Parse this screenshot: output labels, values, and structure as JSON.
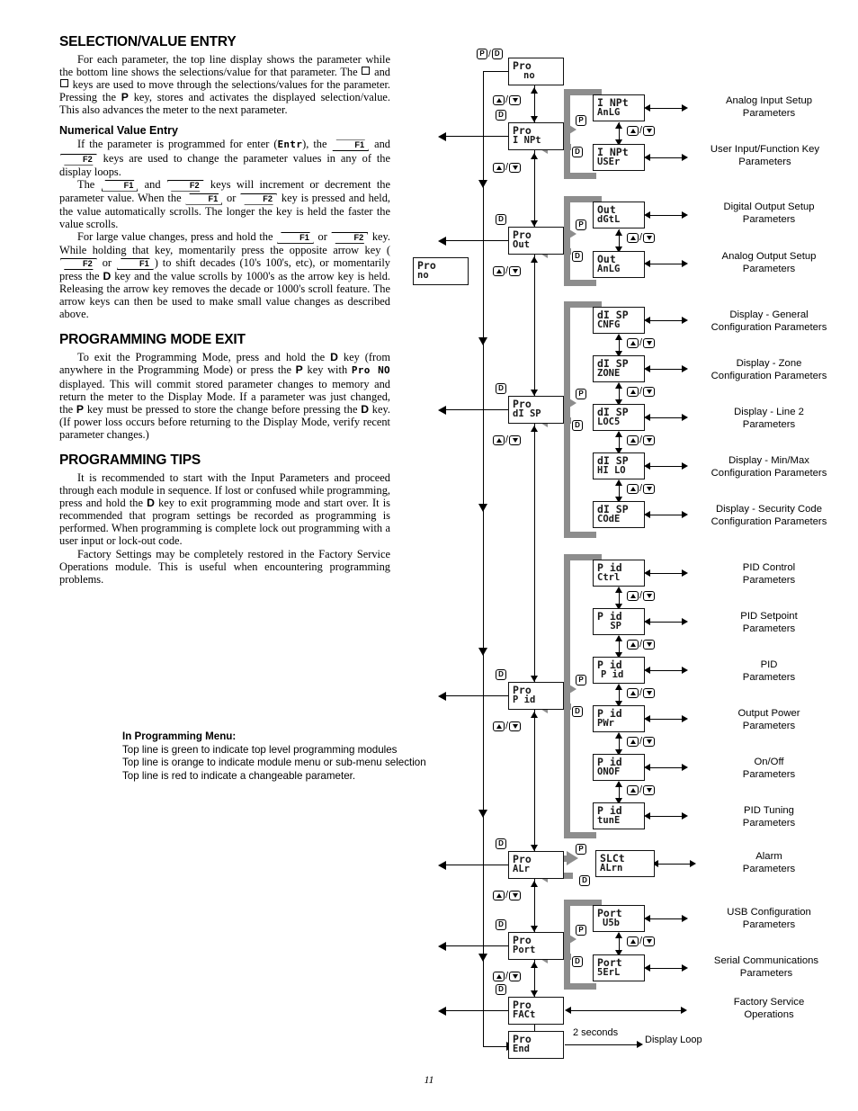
{
  "document": {
    "page_number": "11"
  },
  "sections": [
    {
      "id": "selection_value_entry",
      "heading": "SELECTION/VALUE ENTRY",
      "paragraphs": [
        "For each parameter, the top line display shows the parameter while the bottom line shows the selections/value for that parameter. The □ and □ keys are used to move through the selections/values for the parameter. Pressing the P key, stores and activates the displayed selection/value. This also advances the meter to the next parameter."
      ]
    },
    {
      "id": "numerical_value_entry",
      "heading": "Numerical Value Entry",
      "paragraphs": [
        "If the parameter is programmed for enter (Entr), the F1 and F2 keys are used to change the parameter values in any of the display loops.",
        "The F1 and F2 keys will increment or decrement the parameter value. When the F1 or F2 key is pressed and held, the value automatically scrolls. The longer the key is held the faster the value scrolls.",
        "For large value changes, press and hold the F1 or F2 key. While holding that key, momentarily press the opposite arrow key (F2 or F1) to shift decades (10's 100's, etc), or momentarily press the D key and the value scrolls by 1000's as the arrow key is held. Releasing the arrow key removes the decade or 1000's scroll feature. The arrow keys can then be used to make small value changes as described above."
      ]
    },
    {
      "id": "programming_mode_exit",
      "heading": "PROGRAMMING MODE EXIT",
      "paragraphs": [
        "To exit the Programming Mode, press and hold the D key (from anywhere in the Programming Mode) or press the P key with Pro NO displayed. This will commit stored parameter changes to memory and return the meter to the Display Mode. If a parameter was just changed, the P key must be pressed to store the change before pressing the D key. (If power loss occurs before returning to the Display Mode, verify recent parameter changes.)"
      ]
    },
    {
      "id": "programming_tips",
      "heading": "PROGRAMMING TIPS",
      "paragraphs": [
        "It is recommended to start with the Input Parameters and proceed through each module in sequence. If lost or confused while programming, press and hold the D key to exit programming mode and start over. It is recommended that program settings be recorded as programming is performed. When programming is complete lock out programming with a user input or lock-out code.",
        "Factory Settings may be completely restored in the Factory Service Operations module. This is useful when encountering programming problems."
      ]
    }
  ],
  "note": {
    "title": "In Programming Menu:",
    "lines": [
      "Top line is green to indicate top level programming modules",
      "Top line is orange to indicate module menu or sub-menu selection",
      "Top line is red to indicate a changeable parameter."
    ]
  },
  "flowchart": {
    "legend_box": {
      "line1": "Pro",
      "line2": "no"
    },
    "top_keys": {
      "p": "P",
      "d": "D",
      "slash": "/"
    },
    "key_labels": {
      "p": "P",
      "d": "D"
    },
    "main_modules": [
      {
        "id": "pro-no",
        "line1": "Pro",
        "line2": "no"
      },
      {
        "id": "pro-inpt",
        "line1": "Pro",
        "line2": "I NPt"
      },
      {
        "id": "pro-out",
        "line1": "Pro",
        "line2": "Out"
      },
      {
        "id": "pro-disp",
        "line1": "Pro",
        "line2": "dI SP"
      },
      {
        "id": "pro-pid",
        "line1": "Pro",
        "line2": "P id"
      },
      {
        "id": "pro-alr",
        "line1": "Pro",
        "line2": "ALr"
      },
      {
        "id": "pro-port",
        "line1": "Pro",
        "line2": "Port"
      },
      {
        "id": "pro-fact",
        "line1": "Pro",
        "line2": "FACt"
      },
      {
        "id": "pro-end",
        "line1": "Pro",
        "line2": "End"
      }
    ],
    "submodules": [
      {
        "id": "inpt-anlg",
        "line1": "I NPt",
        "line2": "AnLG",
        "label": "Analog Input Setup\nParameters"
      },
      {
        "id": "inpt-user",
        "line1": "I NPt",
        "line2": "USEr",
        "label": "User Input/Function Key\nParameters"
      },
      {
        "id": "out-dgtl",
        "line1": "Out",
        "line2": "dGtL",
        "label": "Digital Output Setup\nParameters"
      },
      {
        "id": "out-anlg",
        "line1": "Out",
        "line2": "AnLG",
        "label": "Analog Output Setup\nParameters"
      },
      {
        "id": "disp-cnfg",
        "line1": "dI SP",
        "line2": "CNFG",
        "label": "Display - General\nConfiguration Parameters"
      },
      {
        "id": "disp-zone",
        "line1": "dI SP",
        "line2": "ZONE",
        "label": "Display - Zone\nConfiguration Parameters"
      },
      {
        "id": "disp-locs",
        "line1": "dI SP",
        "line2": "LOC5",
        "label": "Display - Line 2\nParameters"
      },
      {
        "id": "disp-hilo",
        "line1": "dI SP",
        "line2": "HI LO",
        "label": "Display - Min/Max\nConfiguration Parameters"
      },
      {
        "id": "disp-code",
        "line1": "dI SP",
        "line2": "COdE",
        "label": "Display - Security Code\nConfiguration Parameters"
      },
      {
        "id": "pid-ctrl",
        "line1": "P id",
        "line2": "Ctrl",
        "label": "PID Control\nParameters"
      },
      {
        "id": "pid-sp",
        "line1": "P id",
        "line2": " SP",
        "label": "PID Setpoint\nParameters"
      },
      {
        "id": "pid-pid",
        "line1": "P id",
        "line2": "P id",
        "label": "PID\nParameters"
      },
      {
        "id": "pid-pwr",
        "line1": "P id",
        "line2": "PWr",
        "label": "Output Power\nParameters"
      },
      {
        "id": "pid-onof",
        "line1": "P id",
        "line2": "ONOF",
        "label": "On/Off\nParameters"
      },
      {
        "id": "pid-tune",
        "line1": "P id",
        "line2": "tunE",
        "label": "PID Tuning\nParameters"
      },
      {
        "id": "alr-slct",
        "line1": "SLCt",
        "line2": "ALrn",
        "label": "Alarm\nParameters"
      },
      {
        "id": "port-usb",
        "line1": "Port",
        "line2": "U5b",
        "label": "USB Configuration\nParameters"
      },
      {
        "id": "port-serl",
        "line1": "Port",
        "line2": "5ErL",
        "label": "Serial Communications\nParameters"
      }
    ],
    "plain_labels": [
      {
        "id": "factory-service",
        "text": "Factory Service\nOperations"
      }
    ],
    "annotations": {
      "two_seconds": "2 seconds",
      "display_loop": "Display Loop"
    }
  }
}
